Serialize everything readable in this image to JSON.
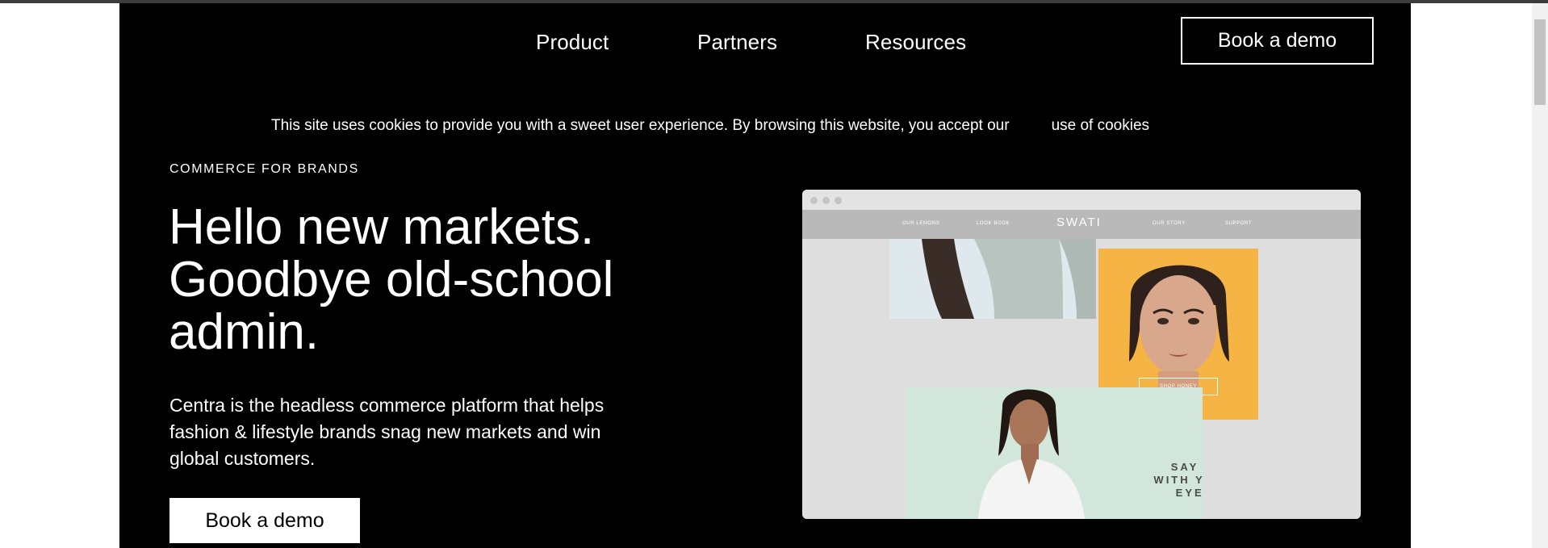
{
  "nav": {
    "product": "Product",
    "partners": "Partners",
    "resources": "Resources",
    "cta": "Book a demo"
  },
  "cookie": {
    "text": "This site uses cookies to provide you with a sweet user experience. By browsing this website, you accept our",
    "link": "use of cookies"
  },
  "hero": {
    "eyebrow": "COMMERCE FOR BRANDS",
    "headline_line1": "Hello new markets.",
    "headline_line2": "Goodbye old-school",
    "headline_line3": "admin.",
    "subtext": "Centra is the headless commerce platform that helps fashion & lifestyle brands snag new markets and win global customers.",
    "cta": "Book a demo"
  },
  "mockup": {
    "logo": "SWATI",
    "nav_items": [
      "OUR LEMONS",
      "LOOK BOOK",
      "OUR STORY",
      "SUPPORT"
    ],
    "shop_button": "SHOP HONEY",
    "tagline_line1": "SAY IT",
    "tagline_line2": "WITH YOUR",
    "tagline_line3": "EYES",
    "colors": {
      "orange": "#f5b444",
      "mint": "#d3e6dc",
      "pale_blue": "#dfe8ec"
    }
  },
  "colors": {
    "background": "#000000",
    "text": "#ffffff"
  }
}
